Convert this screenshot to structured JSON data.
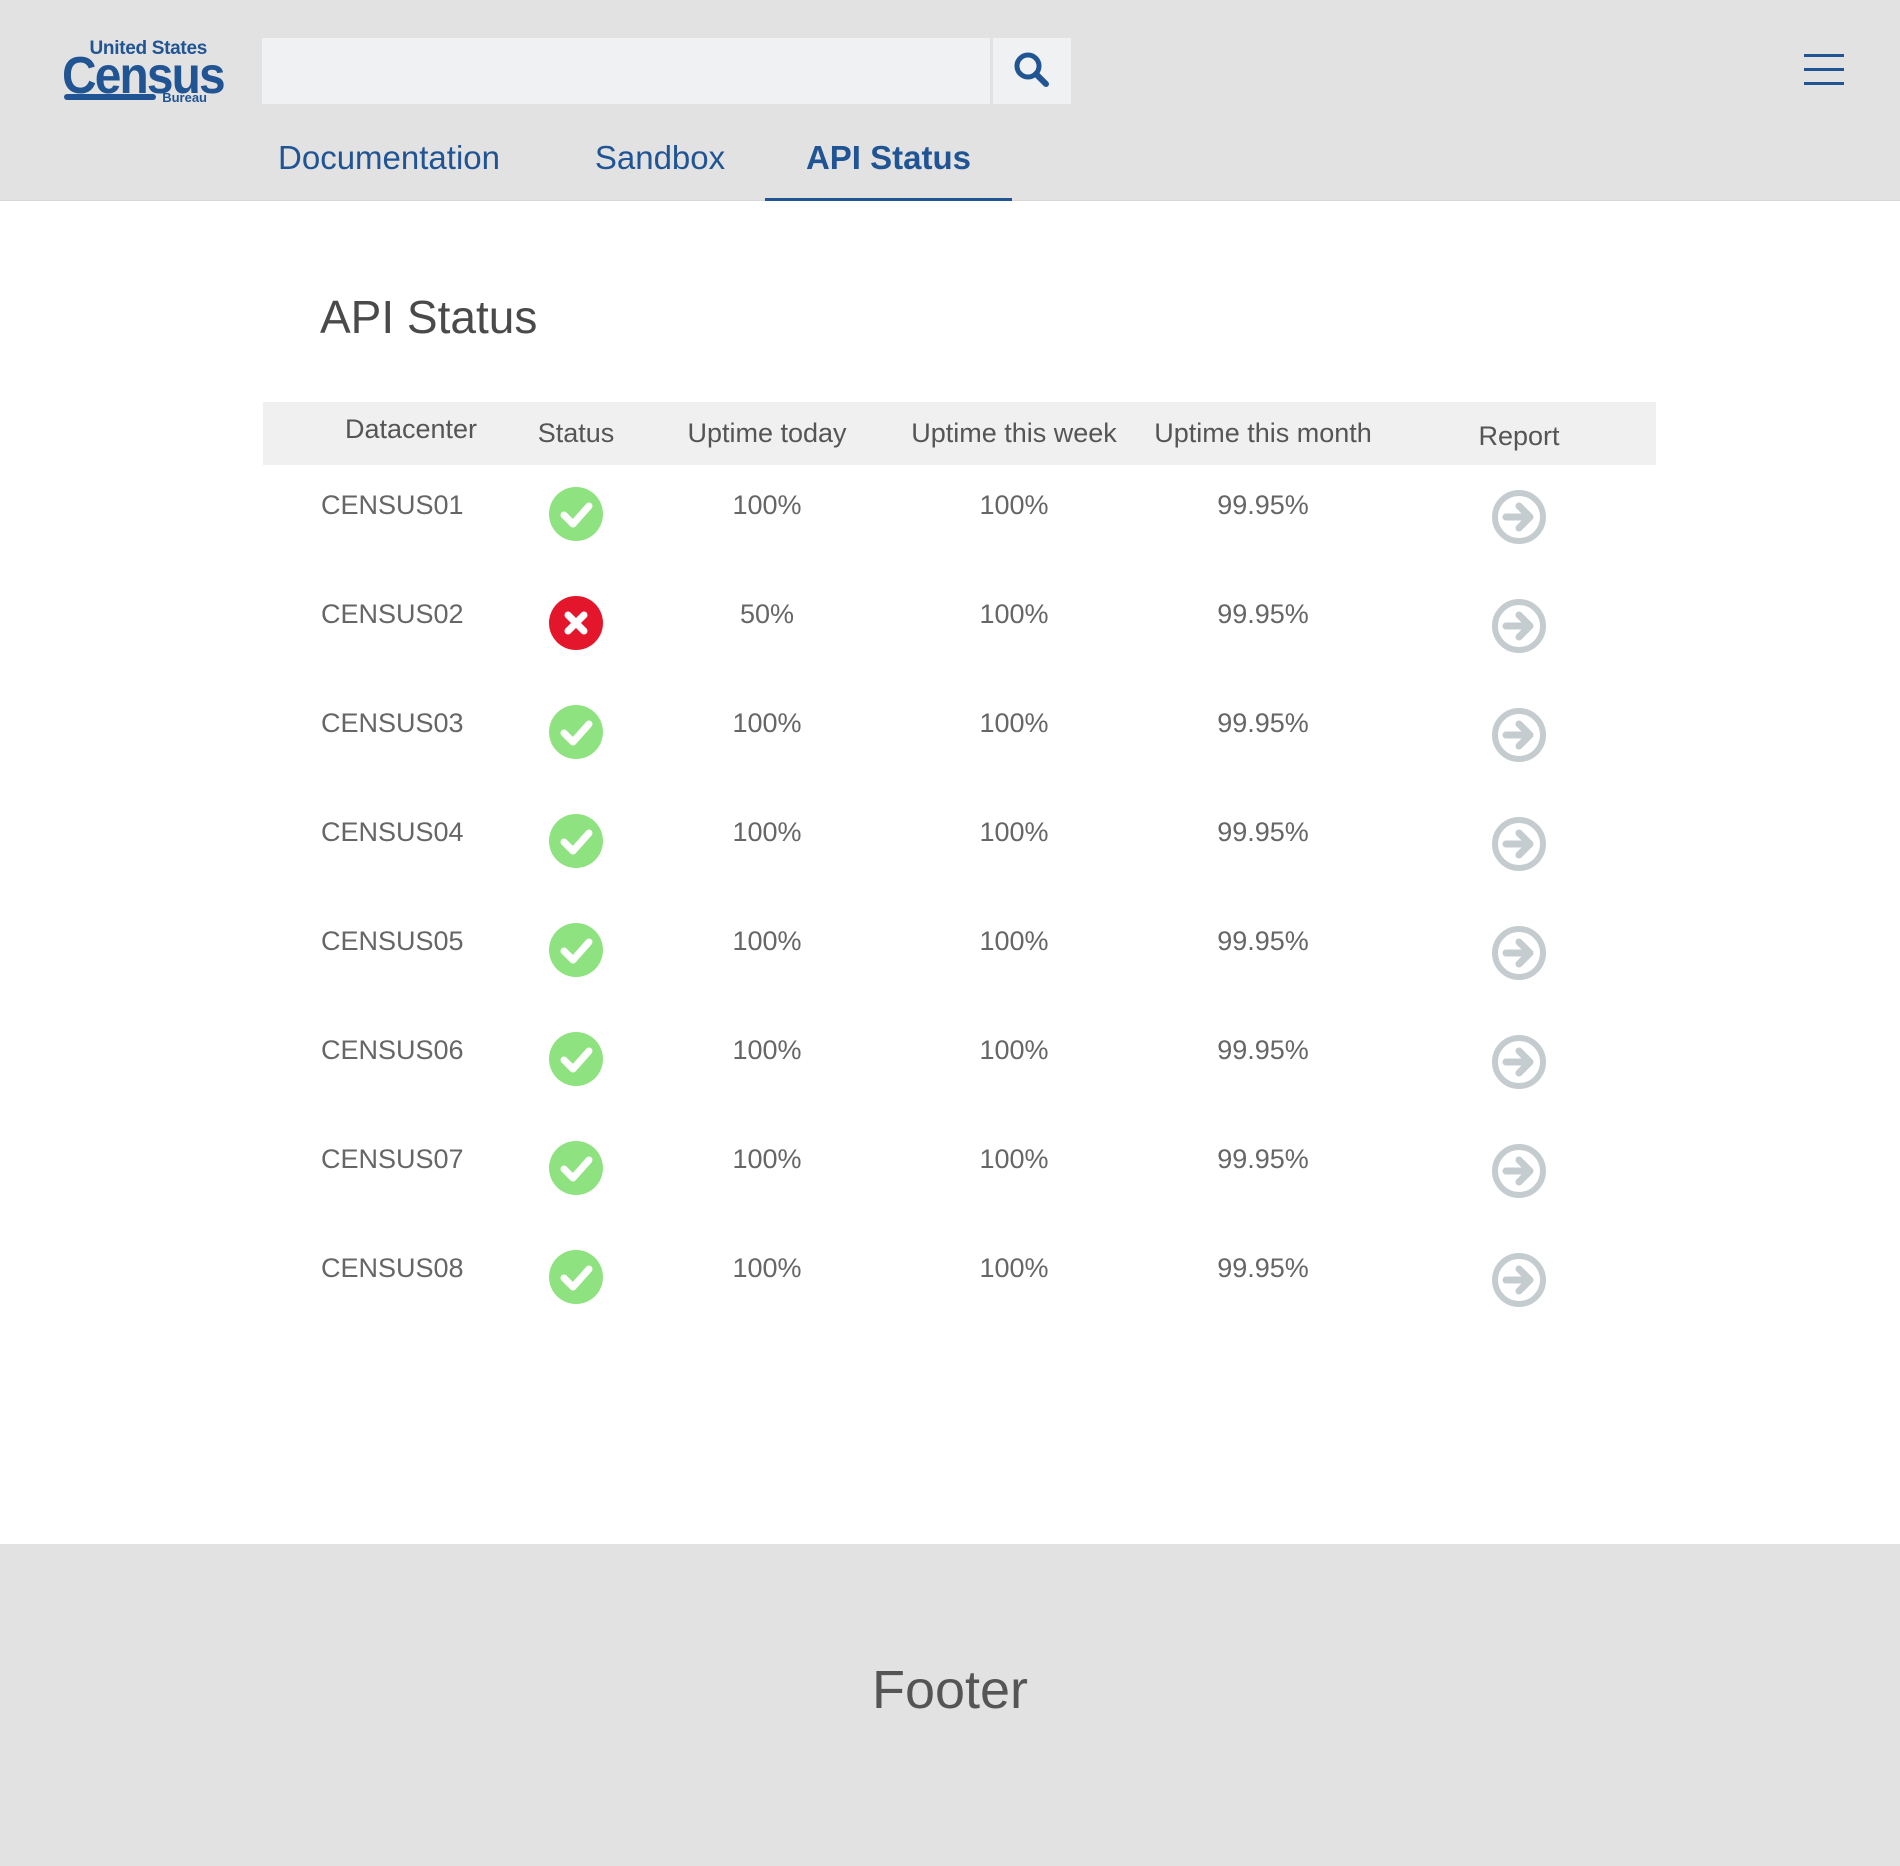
{
  "header": {
    "logo": {
      "top": "United States",
      "main": "Census",
      "bottom": "Bureau"
    },
    "search": {
      "value": "",
      "placeholder": ""
    },
    "nav": {
      "tabs": [
        {
          "label": "Documentation",
          "active": false
        },
        {
          "label": "Sandbox",
          "active": false
        },
        {
          "label": "API Status",
          "active": true
        }
      ]
    }
  },
  "main": {
    "title": "API Status",
    "table": {
      "columns": [
        "Datacenter",
        "Status",
        "Uptime today",
        "Uptime this week",
        "Uptime this month",
        "Report"
      ],
      "rows": [
        {
          "datacenter": "CENSUS01",
          "status": "ok",
          "today": "100%",
          "week": "100%",
          "month": "99.95%"
        },
        {
          "datacenter": "CENSUS02",
          "status": "error",
          "today": "50%",
          "week": "100%",
          "month": "99.95%"
        },
        {
          "datacenter": "CENSUS03",
          "status": "ok",
          "today": "100%",
          "week": "100%",
          "month": "99.95%"
        },
        {
          "datacenter": "CENSUS04",
          "status": "ok",
          "today": "100%",
          "week": "100%",
          "month": "99.95%"
        },
        {
          "datacenter": "CENSUS05",
          "status": "ok",
          "today": "100%",
          "week": "100%",
          "month": "99.95%"
        },
        {
          "datacenter": "CENSUS06",
          "status": "ok",
          "today": "100%",
          "week": "100%",
          "month": "99.95%"
        },
        {
          "datacenter": "CENSUS07",
          "status": "ok",
          "today": "100%",
          "week": "100%",
          "month": "99.95%"
        },
        {
          "datacenter": "CENSUS08",
          "status": "ok",
          "today": "100%",
          "week": "100%",
          "month": "99.95%"
        }
      ]
    }
  },
  "footer": {
    "text": "Footer"
  },
  "icons": {
    "search": "search-icon",
    "menu": "hamburger-menu-icon",
    "status_ok": "check-circle-icon",
    "status_error": "x-circle-icon",
    "report": "arrow-right-circle-icon"
  },
  "colors": {
    "brand": "#205493",
    "status_ok": "#8ee27f",
    "status_error": "#e3162b",
    "report": "#c5ccd0",
    "header_bg": "#e2e2e3"
  }
}
